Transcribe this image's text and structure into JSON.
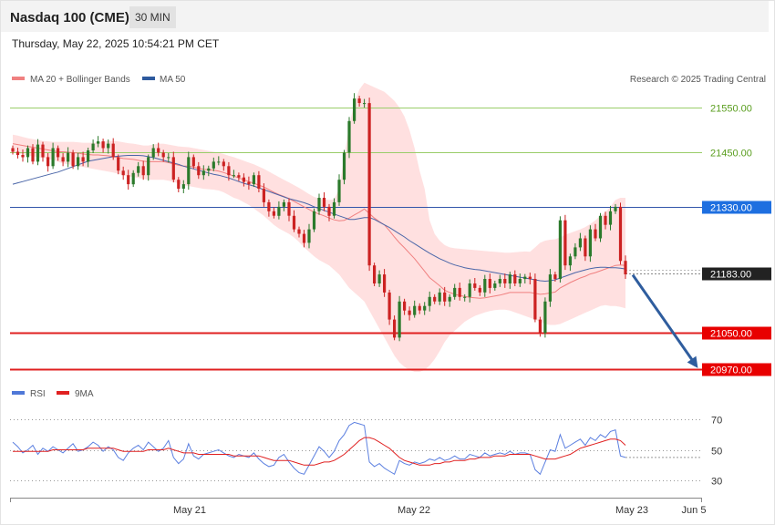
{
  "header": {
    "title": "Nasdaq 100 (CME)",
    "timeframe": "30 MIN",
    "timestamp": "Thursday, May 22, 2025 10:54:21 PM CET"
  },
  "legend": {
    "ma20": "MA 20 + Bollinger Bands",
    "ma50": "MA 50",
    "credit": "Research © 2025 Trading Central",
    "rsi": "RSI",
    "rsi_ma": "9MA"
  },
  "colors": {
    "up": "#2b7a2b",
    "down": "#cc2222",
    "band": "#ffd6d6",
    "ma20": "#f08080",
    "ma50": "#4a66a8",
    "resistance": "#9acd6a",
    "support": "#e02020",
    "pivot": "#3355aa",
    "arrow": "#2f5d9e"
  },
  "chart_data": {
    "type": "candlestick",
    "x_ticks": [
      "May 21",
      "May 22",
      "May 23",
      "Jun 5"
    ],
    "y_range": [
      20950,
      21620
    ],
    "levels": [
      {
        "value": 21550,
        "label": "21550.00",
        "kind": "resistance"
      },
      {
        "value": 21450,
        "label": "21450.00",
        "kind": "resistance"
      },
      {
        "value": 21330,
        "label": "21330.00",
        "kind": "pivot"
      },
      {
        "value": 21183,
        "label": "21183.00",
        "kind": "last"
      },
      {
        "value": 21050,
        "label": "21050.00",
        "kind": "support"
      },
      {
        "value": 20970,
        "label": "20970.00",
        "kind": "support"
      }
    ],
    "closes": [
      21452,
      21445,
      21440,
      21460,
      21430,
      21468,
      21440,
      21420,
      21460,
      21440,
      21430,
      21450,
      21420,
      21440,
      21430,
      21455,
      21470,
      21475,
      21460,
      21470,
      21440,
      21410,
      21400,
      21380,
      21405,
      21420,
      21400,
      21440,
      21460,
      21450,
      21440,
      21440,
      21390,
      21370,
      21380,
      21440,
      21420,
      21400,
      21410,
      21415,
      21430,
      21430,
      21420,
      21400,
      21400,
      21395,
      21385,
      21380,
      21400,
      21370,
      21340,
      21320,
      21310,
      21330,
      21340,
      21310,
      21280,
      21270,
      21250,
      21280,
      21320,
      21350,
      21330,
      21310,
      21340,
      21390,
      21450,
      21520,
      21570,
      21560,
      21560,
      21200,
      21160,
      21180,
      21140,
      21080,
      21040,
      21120,
      21100,
      21090,
      21110,
      21100,
      21110,
      21130,
      21120,
      21140,
      21120,
      21130,
      21150,
      21130,
      21130,
      21160,
      21150,
      21140,
      21170,
      21150,
      21160,
      21170,
      21160,
      21180,
      21160,
      21170,
      21175,
      21170,
      21080,
      21050,
      21120,
      21180,
      21170,
      21300,
      21200,
      21220,
      21240,
      21260,
      21220,
      21280,
      21260,
      21310,
      21290,
      21320,
      21330,
      21210,
      21180
    ],
    "ma20": [
      21470,
      21468,
      21466,
      21464,
      21462,
      21460,
      21458,
      21456,
      21454,
      21452,
      21452,
      21451,
      21450,
      21449,
      21447,
      21446,
      21445,
      21445,
      21444,
      21443,
      21441,
      21439,
      21437,
      21436,
      21435,
      21433,
      21431,
      21430,
      21430,
      21430,
      21430,
      21428,
      21425,
      21422,
      21420,
      21420,
      21418,
      21415,
      21413,
      21412,
      21411,
      21409,
      21406,
      21402,
      21398,
      21394,
      21390,
      21386,
      21382,
      21378,
      21374,
      21368,
      21362,
      21357,
      21353,
      21348,
      21342,
      21336,
      21330,
      21324,
      21318,
      21314,
      21310,
      21305,
      21301,
      21299,
      21300,
      21305,
      21312,
      21318,
      21325,
      21315,
      21305,
      21297,
      21290,
      21277,
      21263,
      21250,
      21239,
      21227,
      21215,
      21201,
      21187,
      21173,
      21164,
      21155,
      21145,
      21140,
      21136,
      21133,
      21131,
      21129,
      21128,
      21127,
      21128,
      21130,
      21132,
      21134,
      21137,
      21140,
      21140,
      21140,
      21140,
      21140,
      21138,
      21136,
      21137,
      21139,
      21141,
      21150,
      21156,
      21162,
      21167,
      21172,
      21176,
      21181,
      21184,
      21188,
      21192,
      21196,
      21200,
      21201,
      21200
    ],
    "ma50": [
      21380,
      21383,
      21386,
      21389,
      21392,
      21395,
      21398,
      21401,
      21404,
      21407,
      21411,
      21415,
      21419,
      21423,
      21427,
      21431,
      21433,
      21435,
      21437,
      21439,
      21441,
      21442,
      21443,
      21444,
      21444,
      21444,
      21443,
      21441,
      21439,
      21436,
      21433,
      21430,
      21427,
      21424,
      21420,
      21417,
      21414,
      21411,
      21408,
      21405,
      21402,
      21400,
      21397,
      21394,
      21390,
      21386,
      21382,
      21379,
      21376,
      21372,
      21368,
      21364,
      21360,
      21356,
      21352,
      21348,
      21345,
      21342,
      21339,
      21335,
      21330,
      21326,
      21322,
      21318,
      21314,
      21310,
      21306,
      21302,
      21302,
      21304,
      21306,
      21306,
      21302,
      21296,
      21290,
      21284,
      21277,
      21270,
      21263,
      21255,
      21248,
      21241,
      21234,
      21227,
      21221,
      21215,
      21210,
      21205,
      21201,
      21198,
      21195,
      21193,
      21191,
      21190,
      21188,
      21186,
      21184,
      21182,
      21180,
      21178,
      21176,
      21174,
      21172,
      21170,
      21168,
      21166,
      21165,
      21166,
      21168,
      21172,
      21176,
      21180,
      21184,
      21187,
      21190,
      21193,
      21195,
      21196,
      21196,
      21195,
      21195,
      21194,
      21192
    ],
    "bb_upper": [
      21490,
      21488,
      21485,
      21482,
      21480,
      21478,
      21476,
      21475,
      21474,
      21474,
      21474,
      21474,
      21474,
      21473,
      21472,
      21472,
      21472,
      21473,
      21474,
      21476,
      21476,
      21475,
      21473,
      21471,
      21470,
      21468,
      21466,
      21466,
      21468,
      21470,
      21470,
      21468,
      21466,
      21464,
      21463,
      21462,
      21460,
      21458,
      21456,
      21454,
      21452,
      21450,
      21447,
      21443,
      21440,
      21436,
      21432,
      21428,
      21424,
      21419,
      21414,
      21408,
      21402,
      21396,
      21390,
      21384,
      21378,
      21372,
      21365,
      21358,
      21352,
      21348,
      21346,
      21345,
      21346,
      21370,
      21440,
      21510,
      21560,
      21590,
      21605,
      21600,
      21595,
      21590,
      21585,
      21575,
      21565,
      21550,
      21530,
      21500,
      21460,
      21410,
      21370,
      21300,
      21270,
      21255,
      21245,
      21240,
      21238,
      21237,
      21236,
      21235,
      21234,
      21233,
      21232,
      21231,
      21230,
      21229,
      21228,
      21228,
      21229,
      21230,
      21231,
      21230,
      21240,
      21250,
      21255,
      21257,
      21258,
      21262,
      21268,
      21272,
      21276,
      21280,
      21285,
      21292,
      21300,
      21310,
      21318,
      21330,
      21345,
      21350,
      21350
    ],
    "bb_lower": [
      21450,
      21448,
      21446,
      21444,
      21442,
      21440,
      21438,
      21436,
      21434,
      21430,
      21426,
      21424,
      21422,
      21420,
      21418,
      21416,
      21414,
      21412,
      21410,
      21408,
      21406,
      21403,
      21400,
      21398,
      21396,
      21394,
      21392,
      21390,
      21390,
      21390,
      21390,
      21388,
      21385,
      21382,
      21378,
      21376,
      21374,
      21372,
      21370,
      21369,
      21368,
      21366,
      21362,
      21356,
      21350,
      21346,
      21340,
      21334,
      21326,
      21318,
      21310,
      21300,
      21290,
      21282,
      21276,
      21270,
      21262,
      21252,
      21240,
      21230,
      21220,
      21212,
      21206,
      21200,
      21190,
      21180,
      21165,
      21150,
      21140,
      21130,
      21120,
      21100,
      21080,
      21060,
      21040,
      21020,
      21000,
      20985,
      20975,
      20968,
      20964,
      20964,
      20968,
      20978,
      20992,
      21010,
      21030,
      21045,
      21055,
      21065,
      21075,
      21082,
      21088,
      21092,
      21096,
      21099,
      21101,
      21102,
      21102,
      21100,
      21096,
      21092,
      21088,
      21084,
      21080,
      21075,
      21070,
      21068,
      21068,
      21070,
      21075,
      21080,
      21085,
      21090,
      21095,
      21100,
      21105,
      21110,
      21112,
      21110,
      21110,
      21108,
      21105
    ],
    "rsi": {
      "y_ticks": [
        70,
        50,
        30
      ],
      "range": [
        20,
        80
      ],
      "values": [
        55,
        52,
        48,
        50,
        53,
        47,
        51,
        49,
        52,
        50,
        48,
        51,
        54,
        49,
        50,
        52,
        55,
        53,
        49,
        52,
        50,
        45,
        43,
        48,
        51,
        53,
        50,
        55,
        52,
        49,
        51,
        56,
        45,
        41,
        44,
        54,
        46,
        44,
        47,
        48,
        49,
        50,
        48,
        46,
        45,
        47,
        46,
        45,
        48,
        44,
        41,
        39,
        40,
        45,
        47,
        42,
        38,
        35,
        34,
        40,
        46,
        52,
        49,
        45,
        49,
        56,
        60,
        66,
        68,
        67,
        66,
        42,
        39,
        41,
        38,
        36,
        34,
        43,
        41,
        40,
        42,
        41,
        42,
        44,
        43,
        45,
        43,
        44,
        46,
        44,
        44,
        47,
        46,
        45,
        48,
        46,
        47,
        48,
        47,
        49,
        47,
        48,
        48,
        47,
        37,
        34,
        42,
        50,
        49,
        60,
        51,
        53,
        55,
        57,
        53,
        58,
        56,
        60,
        58,
        62,
        63,
        46,
        45
      ],
      "ma9": [
        49,
        49,
        49,
        49,
        49,
        49,
        49,
        49,
        50,
        50,
        50,
        50,
        50,
        50,
        50,
        51,
        51,
        51,
        51,
        51,
        51,
        50,
        49,
        49,
        49,
        49,
        49,
        50,
        50,
        50,
        50,
        51,
        50,
        49,
        48,
        48,
        48,
        47,
        47,
        47,
        47,
        47,
        47,
        47,
        46,
        46,
        46,
        46,
        46,
        46,
        45,
        44,
        43,
        43,
        43,
        43,
        42,
        41,
        40,
        40,
        40,
        41,
        42,
        42,
        43,
        45,
        47,
        50,
        53,
        56,
        58,
        58,
        57,
        55,
        53,
        51,
        48,
        45,
        43,
        42,
        41,
        40,
        40,
        40,
        41,
        41,
        42,
        42,
        43,
        43,
        43,
        44,
        44,
        45,
        45,
        45,
        46,
        46,
        46,
        47,
        47,
        47,
        47,
        47,
        46,
        45,
        44,
        44,
        44,
        45,
        46,
        47,
        49,
        51,
        52,
        53,
        54,
        55,
        56,
        57,
        57,
        56,
        53
      ]
    }
  },
  "arrow": {
    "from_value": 21183,
    "to_value": 20970
  }
}
